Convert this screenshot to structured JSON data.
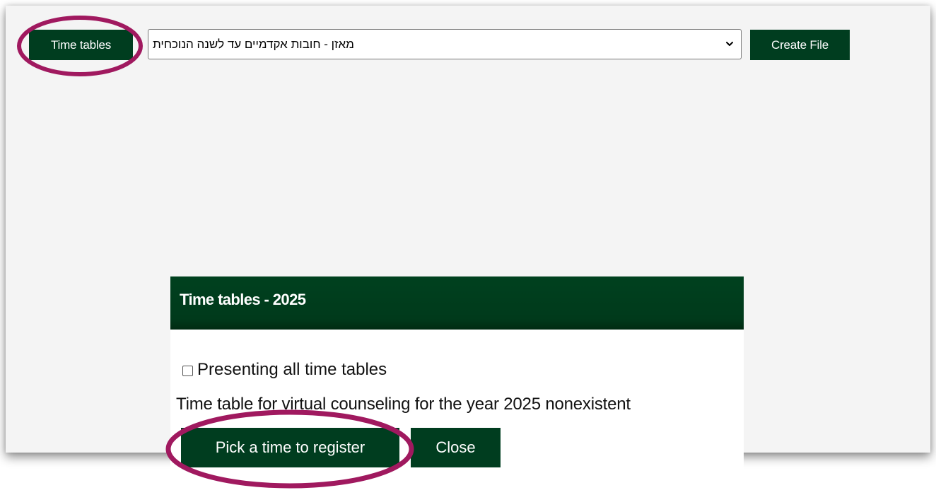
{
  "toolbar": {
    "time_tables_label": "Time tables",
    "select_value": "מאזן - חובות אקדמיים עד לשנה הנוכחית",
    "create_file_label": "Create File"
  },
  "dialog": {
    "title": "Time tables - 2025",
    "checkbox_label": "Presenting all time tables",
    "checkbox_checked": false,
    "info_text": "Time table for virtual counseling for the year 2025 nonexistent",
    "pick_button_label": "Pick a time to register",
    "close_button_label": "Close"
  },
  "colors": {
    "primary_green": "#003d1f",
    "highlight_ring": "#a0195f",
    "page_background": "#f4f4f4"
  },
  "icons": {
    "select_arrow": "chevron-down-icon"
  }
}
